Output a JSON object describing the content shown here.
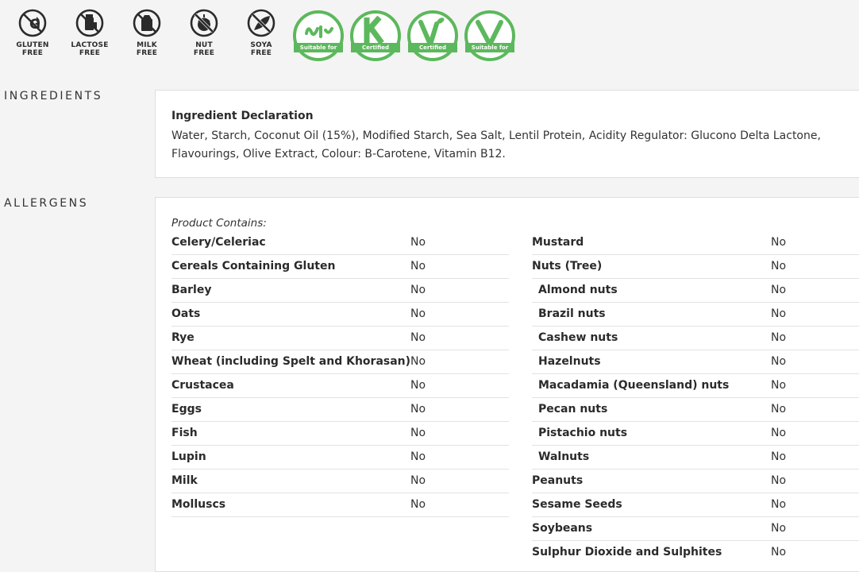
{
  "free_icons": [
    {
      "icon": "gluten-free-icon",
      "line1": "GLUTEN",
      "line2": "FREE"
    },
    {
      "icon": "lactose-free-icon",
      "line1": "LACTOSE",
      "line2": "FREE"
    },
    {
      "icon": "milk-free-icon",
      "line1": "MILK",
      "line2": "FREE"
    },
    {
      "icon": "nut-free-icon",
      "line1": "NUT",
      "line2": "FREE"
    },
    {
      "icon": "soya-free-icon",
      "line1": "SOYA",
      "line2": "FREE"
    }
  ],
  "cert_icons": [
    {
      "icon": "halal-icon",
      "badge": "Suitable for"
    },
    {
      "icon": "kosher-icon",
      "badge": "Certified"
    },
    {
      "icon": "vegan-icon",
      "badge": "Certified"
    },
    {
      "icon": "vegetarian-icon",
      "badge": "Suitable for"
    }
  ],
  "colors": {
    "accent_green": "#5cb85c",
    "icon_dark": "#2b2b2b"
  },
  "ingredients": {
    "section_title": "INGREDIENTS",
    "title": "Ingredient Declaration",
    "text": "Water, Starch, Coconut Oil (15%), Modified Starch, Sea Salt, Lentil Protein, Acidity Regulator: Glucono Delta Lactone, Flavourings, Olive Extract, Colour: B-Carotene, Vitamin B12."
  },
  "allergens": {
    "section_title": "ALLERGENS",
    "contains_label": "Product Contains:",
    "left": [
      {
        "name": "Celery/Celeriac",
        "value": "No"
      },
      {
        "name": "Cereals Containing Gluten",
        "value": "No"
      },
      {
        "name": "Barley",
        "value": "No"
      },
      {
        "name": "Oats",
        "value": "No"
      },
      {
        "name": "Rye",
        "value": "No"
      },
      {
        "name": "Wheat (including Spelt and Khorasan)",
        "value": "No"
      },
      {
        "name": "Crustacea",
        "value": "No"
      },
      {
        "name": "Eggs",
        "value": "No"
      },
      {
        "name": "Fish",
        "value": "No"
      },
      {
        "name": "Lupin",
        "value": "No"
      },
      {
        "name": "Milk",
        "value": "No"
      },
      {
        "name": "Molluscs",
        "value": "No"
      }
    ],
    "right": [
      {
        "name": "Mustard",
        "value": "No",
        "sub": false
      },
      {
        "name": "Nuts (Tree)",
        "value": "No",
        "sub": false
      },
      {
        "name": "Almond nuts",
        "value": "No",
        "sub": true
      },
      {
        "name": "Brazil nuts",
        "value": "No",
        "sub": true
      },
      {
        "name": "Cashew nuts",
        "value": "No",
        "sub": true
      },
      {
        "name": "Hazelnuts",
        "value": "No",
        "sub": true
      },
      {
        "name": "Macadamia (Queensland) nuts",
        "value": "No",
        "sub": true
      },
      {
        "name": "Pecan nuts",
        "value": "No",
        "sub": true
      },
      {
        "name": "Pistachio nuts",
        "value": "No",
        "sub": true
      },
      {
        "name": "Walnuts",
        "value": "No",
        "sub": true
      },
      {
        "name": "Peanuts",
        "value": "No",
        "sub": false
      },
      {
        "name": "Sesame Seeds",
        "value": "No",
        "sub": false
      },
      {
        "name": "Soybeans",
        "value": "No",
        "sub": false
      },
      {
        "name": "Sulphur Dioxide and Sulphites",
        "value": "No",
        "sub": false
      }
    ]
  }
}
